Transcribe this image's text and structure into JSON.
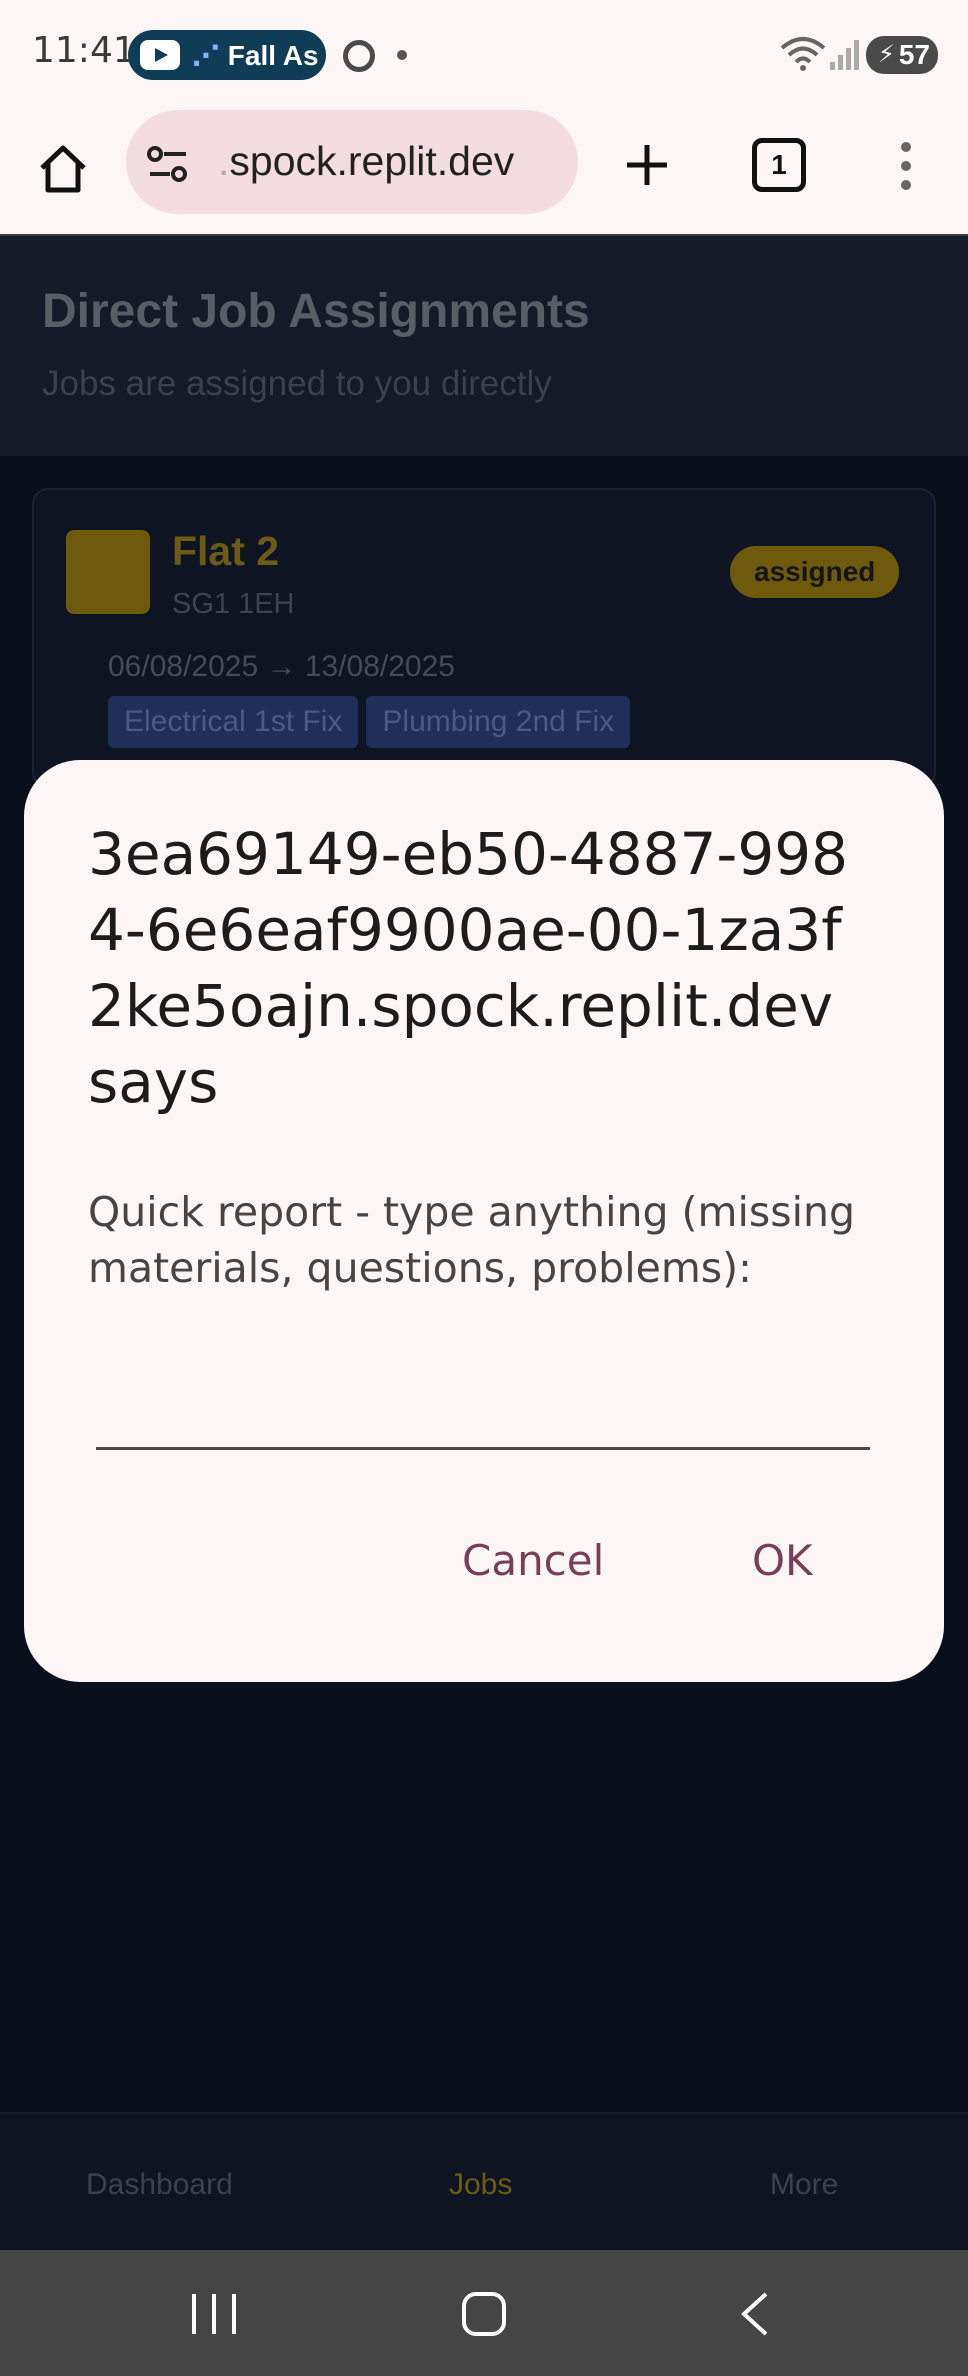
{
  "status_bar": {
    "time": "11:41",
    "media_pill_text": "Fall As",
    "battery": "57"
  },
  "browser": {
    "url_faded": ".",
    "url": "spock.replit.dev",
    "tab_count": "1"
  },
  "page": {
    "title": "Direct Job Assignments",
    "subtitle": "Jobs are assigned to you directly",
    "job": {
      "title": "Flat 2",
      "postcode": "SG1 1EH",
      "status": "assigned",
      "dates": "06/08/2025 → 13/08/2025",
      "tags": [
        "Electrical 1st Fix",
        "Plumbing 2nd Fix"
      ]
    },
    "bottom_nav": [
      "Dashboard",
      "Jobs",
      "More"
    ]
  },
  "dialog": {
    "title": "3ea69149-eb50-4887-9984-6e6eaf9900ae-00-1za3f2ke5oajn.spock.replit.dev says",
    "message": "Quick report - type anything (missing materials, questions, problems):",
    "input_value": "",
    "cancel_label": "Cancel",
    "ok_label": "OK"
  },
  "colors": {
    "accent": "#7a3e58",
    "job_accent": "#6d5a0d",
    "page_bg": "#0a0f1c"
  }
}
